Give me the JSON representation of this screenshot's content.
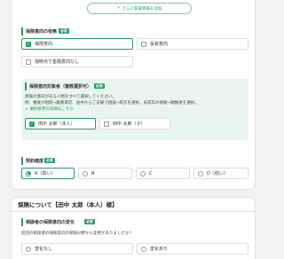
{
  "add_button": {
    "icon": "+",
    "label": "さらに家族情報を追加"
  },
  "required_badge": "必須",
  "insurance_intent": {
    "label": "保険意向の有無",
    "options": [
      {
        "label": "保険意向",
        "checked": true
      },
      {
        "label": "投資意向",
        "checked": false
      },
      {
        "label": "現時点で金融意向なし",
        "checked": false
      }
    ]
  },
  "target": {
    "label": "保険意向対象者（複数選択可）",
    "note1": "保険の意向がある人物をすべて選択してください。",
    "note2": "例：養後が相続→義務運営、途中からご夫婦で相談→両方を選択、未成年の保険→親権者を選択。",
    "link": "+ 選択基準の詳細はこちら",
    "options": [
      {
        "label": "田中 太郎（本人）",
        "checked": true
      },
      {
        "label": "田中 太郎（子）",
        "checked": false
      }
    ]
  },
  "contract": {
    "label": "契約確度",
    "options": [
      {
        "label": "A（高い）",
        "selected": true
      },
      {
        "label": "B",
        "selected": false
      },
      {
        "label": "C",
        "selected": false
      },
      {
        "label": "D（低い）",
        "selected": false
      }
    ]
  },
  "section2": {
    "title": "保険について【田中 太郎（本人）様】",
    "question_label": "相談者の保険意向の変化",
    "question": "前回の相談者の保険意向の保険分野から変更がありましたか？",
    "options": [
      {
        "label": "変化なし",
        "selected": false
      },
      {
        "label": "変化あり",
        "selected": false
      }
    ]
  }
}
